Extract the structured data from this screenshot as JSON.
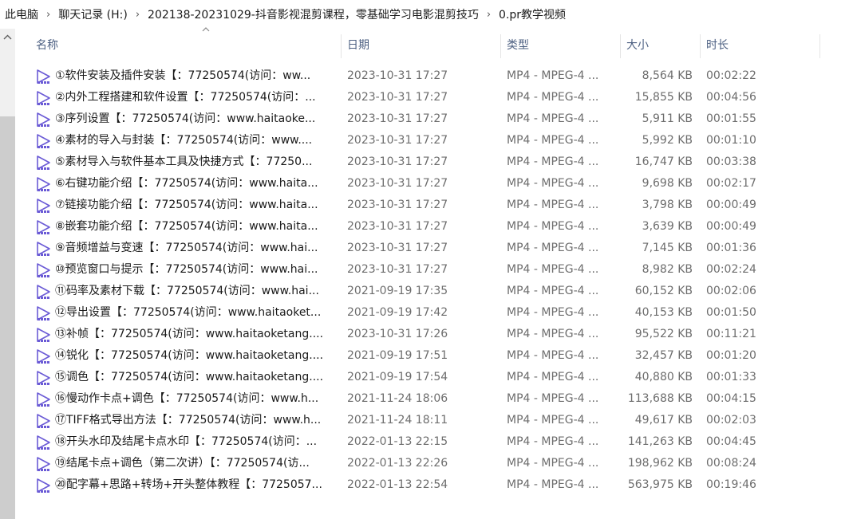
{
  "breadcrumb": [
    "此电脑",
    "聊天记录 (H:)",
    "202138-20231029-抖音影视混剪课程，零基础学习电影混剪技巧",
    "0.pr教学视频"
  ],
  "breadcrumb_separator": "›",
  "columns": {
    "name": "名称",
    "date": "日期",
    "type": "类型",
    "size": "大小",
    "duration": "时长"
  },
  "file_icon": "video-file-play-icon",
  "colors": {
    "header_text": "#4d6082",
    "icon_purple": "#6b5bd6",
    "meta_text": "#6d6d6d"
  },
  "files": [
    {
      "name": "①软件安装及插件安装【：77250574(访问：ww...",
      "date": "2023-10-31 17:27",
      "type": "MP4 - MPEG-4 ...",
      "size": "8,564 KB",
      "duration": "00:02:22"
    },
    {
      "name": "②内外工程搭建和软件设置【：77250574(访问：...",
      "date": "2023-10-31 17:27",
      "type": "MP4 - MPEG-4 ...",
      "size": "15,855 KB",
      "duration": "00:04:56"
    },
    {
      "name": "③序列设置【：77250574(访问：www.haitaoke...",
      "date": "2023-10-31 17:27",
      "type": "MP4 - MPEG-4 ...",
      "size": "5,911 KB",
      "duration": "00:01:55"
    },
    {
      "name": "④素材的导入与封装【：77250574(访问：www....",
      "date": "2023-10-31 17:27",
      "type": "MP4 - MPEG-4 ...",
      "size": "5,992 KB",
      "duration": "00:01:10"
    },
    {
      "name": "⑤素材导入与软件基本工具及快捷方式【：77250...",
      "date": "2023-10-31 17:27",
      "type": "MP4 - MPEG-4 ...",
      "size": "16,747 KB",
      "duration": "00:03:38"
    },
    {
      "name": "⑥右键功能介绍【：77250574(访问：www.haita...",
      "date": "2023-10-31 17:27",
      "type": "MP4 - MPEG-4 ...",
      "size": "9,698 KB",
      "duration": "00:02:17"
    },
    {
      "name": "⑦链接功能介绍【：77250574(访问：www.haita...",
      "date": "2023-10-31 17:27",
      "type": "MP4 - MPEG-4 ...",
      "size": "3,798 KB",
      "duration": "00:00:49"
    },
    {
      "name": "⑧嵌套功能介绍【：77250574(访问：www.haita...",
      "date": "2023-10-31 17:27",
      "type": "MP4 - MPEG-4 ...",
      "size": "3,639 KB",
      "duration": "00:00:49"
    },
    {
      "name": "⑨音频增益与变速【：77250574(访问：www.hai...",
      "date": "2023-10-31 17:27",
      "type": "MP4 - MPEG-4 ...",
      "size": "7,145 KB",
      "duration": "00:01:36"
    },
    {
      "name": "⑩预览窗口与提示【：77250574(访问：www.hai...",
      "date": "2023-10-31 17:27",
      "type": "MP4 - MPEG-4 ...",
      "size": "8,982 KB",
      "duration": "00:02:24"
    },
    {
      "name": "⑪码率及素材下载【：77250574(访问：www.hai...",
      "date": "2021-09-19 17:35",
      "type": "MP4 - MPEG-4 ...",
      "size": "60,152 KB",
      "duration": "00:02:06"
    },
    {
      "name": "⑫导出设置【：77250574(访问：www.haitaoket...",
      "date": "2021-09-19 17:42",
      "type": "MP4 - MPEG-4 ...",
      "size": "40,153 KB",
      "duration": "00:01:50"
    },
    {
      "name": "⑬补帧【：77250574(访问：www.haitaoketang....",
      "date": "2023-10-31 17:26",
      "type": "MP4 - MPEG-4 ...",
      "size": "95,522 KB",
      "duration": "00:11:21"
    },
    {
      "name": "⑭锐化【：77250574(访问：www.haitaoketang....",
      "date": "2021-09-19 17:51",
      "type": "MP4 - MPEG-4 ...",
      "size": "32,457 KB",
      "duration": "00:01:20"
    },
    {
      "name": "⑮调色【：77250574(访问：www.haitaoketang....",
      "date": "2021-09-19 17:54",
      "type": "MP4 - MPEG-4 ...",
      "size": "40,880 KB",
      "duration": "00:01:33"
    },
    {
      "name": "⑯慢动作卡点+调色【：77250574(访问：www.h...",
      "date": "2021-11-24 18:06",
      "type": "MP4 - MPEG-4 ...",
      "size": "113,688 KB",
      "duration": "00:04:15"
    },
    {
      "name": "⑰TIFF格式导出方法【：77250574(访问：www.h...",
      "date": "2021-11-24 18:11",
      "type": "MP4 - MPEG-4 ...",
      "size": "49,617 KB",
      "duration": "00:02:03"
    },
    {
      "name": "⑱开头水印及结尾卡点水印【：77250574(访问：...",
      "date": "2022-01-13 22:15",
      "type": "MP4 - MPEG-4 ...",
      "size": "141,263 KB",
      "duration": "00:04:45"
    },
    {
      "name": "⑲结尾卡点+调色（第二次讲）【：77250574(访...",
      "date": "2022-01-13 22:26",
      "type": "MP4 - MPEG-4 ...",
      "size": "198,962 KB",
      "duration": "00:08:24"
    },
    {
      "name": "⑳配字幕+思路+转场+开头整体教程【：7725057...",
      "date": "2022-01-13 22:54",
      "type": "MP4 - MPEG-4 ...",
      "size": "563,975 KB",
      "duration": "00:19:46"
    }
  ]
}
